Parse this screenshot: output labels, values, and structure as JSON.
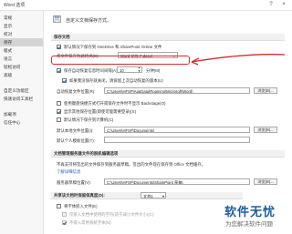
{
  "window": {
    "title": "Word 选项",
    "help": "?",
    "close": "×"
  },
  "sidebar": {
    "items": [
      {
        "label": "常规"
      },
      {
        "label": "显示"
      },
      {
        "label": "校对"
      },
      {
        "label": "保存",
        "active": true
      },
      {
        "label": "版式"
      },
      {
        "label": "语言"
      },
      {
        "label": "轻松访问"
      },
      {
        "label": "高级"
      },
      {
        "label": "自定义功能区"
      },
      {
        "label": "快速访问工具栏"
      },
      {
        "label": "加载项"
      },
      {
        "label": "信任中心"
      }
    ]
  },
  "header": {
    "text": "自定义文档保存方式。"
  },
  "save_docs": {
    "section": "保存文档",
    "onedrive": "默认情况下保存到 OneDrive 和 SharePoint Online 文件",
    "format_label": "将文件保存为此格式(E):",
    "format_value": "Word 文档 (*.docx)",
    "autosave_label": "保存自动恢复信息时间间隔(A)",
    "autosave_value": "10",
    "autosave_unit": "分钟(M)",
    "keep_last": "如果我没保存就关闭，请保留上次自动恢复的版本(U)",
    "recover_label": "自动恢复文件位置(R):",
    "recover_path": "C:\\Users\\HFSP\\AppData\\Roaming\\Microsoft\\Word\\",
    "browse": "浏览(B)...",
    "backstage": "使用键盘快捷方式打开或保存文件时不显示 Backstage(O)",
    "more_locations": "显示其他保存位置(即使可能需要登录)(S)",
    "default_computer": "默认情况下保存到计算机(C)",
    "default_local_label": "默认本地文件位置(I):",
    "default_local_path": "C:\\Users\\HFSP\\Documents\\",
    "browse2": "浏览(B)...",
    "template_label": "默认个人模板位置(T):",
    "template_path": ""
  },
  "offline": {
    "section": "文档管理服务器文件的脱机编辑选项",
    "desc": "不再支持将签出的文件保存到服务器草稿。签出的文件现在保存到 Office 文档缓存。",
    "link": "了解详细信息",
    "drafts_label": "服务器草稿位置(V):",
    "drafts_path": "C:\\Users\\HFSP\\Documents\\SharePoint 草稿\\",
    "browse": "浏览(B)..."
  },
  "fidelity": {
    "section": "共享该文档时保留保真度(D):",
    "doc_name": "文档1",
    "embed_fonts": "将字体嵌入文件(E)",
    "embed_only_used": "仅嵌入文档中使用的字符(适于减小文件大小)(C)",
    "no_common_fonts": "不嵌入常用系统字体(N)"
  },
  "watermark": {
    "title": "软件无忧",
    "subtitle": "为您解决软件问题"
  },
  "colors": {
    "highlight": "#d52b2b",
    "link": "#2a5ea8",
    "brand": "#1c5f9e"
  }
}
